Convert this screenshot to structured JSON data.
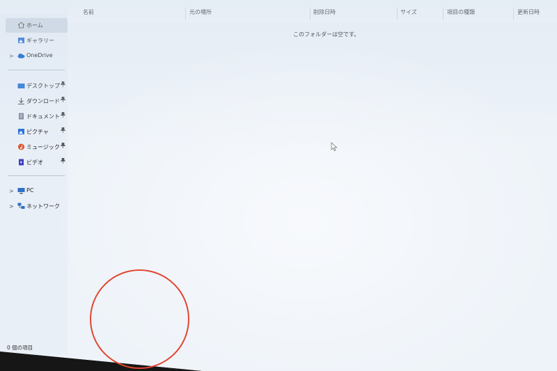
{
  "sidebar": {
    "items": [
      {
        "label": "ホーム",
        "icon": "home-icon",
        "selected": true
      },
      {
        "label": "ギャラリー",
        "icon": "gallery-icon"
      },
      {
        "label": "OneDrive",
        "icon": "onedrive-icon",
        "expandable": true
      },
      {
        "label": "デスクトップ",
        "icon": "desktop-folder-icon",
        "pinned": true
      },
      {
        "label": "ダウンロード",
        "icon": "download-icon",
        "pinned": true
      },
      {
        "label": "ドキュメント",
        "icon": "document-icon",
        "pinned": true
      },
      {
        "label": "ピクチャ",
        "icon": "pictures-icon",
        "pinned": true
      },
      {
        "label": "ミュージック",
        "icon": "music-icon",
        "pinned": true
      },
      {
        "label": "ビデオ",
        "icon": "video-icon",
        "pinned": true
      },
      {
        "label": "PC",
        "icon": "pc-icon",
        "expandable": true
      },
      {
        "label": "ネットワーク",
        "icon": "network-icon",
        "expandable": true
      }
    ],
    "chevron": ">",
    "pin_glyph": "📌"
  },
  "columns": [
    "名前",
    "元の場所",
    "削除日時",
    "サイズ",
    "項目の種類",
    "更新日時"
  ],
  "empty_message": "このフォルダーは空です。",
  "status_bar": {
    "item_count": "0 個の項目"
  },
  "colors": {
    "accent": "#0067c0",
    "annotation_circle": "#e2452f",
    "selection": "#cfd8e3"
  }
}
